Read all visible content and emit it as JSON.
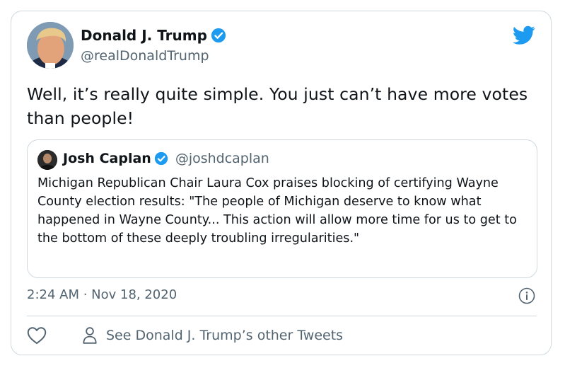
{
  "tweet": {
    "author_name": "Donald J. Trump",
    "author_handle": "@realDonaldTrump",
    "text": "Well, it’s really quite simple. You just can’t have more votes than people!",
    "timestamp": "2:24 AM · Nov 18, 2020"
  },
  "quoted_tweet": {
    "author_name": "Josh Caplan",
    "author_handle": "@joshdcaplan",
    "text": "Michigan Republican Chair Laura Cox praises blocking of certifying Wayne County election results: \"The people of Michigan deserve to know what happened in Wayne County... This action will allow more time for us to get to the bottom of these deeply troubling irregularities.\""
  },
  "actions": {
    "other_tweets_label": "See Donald J. Trump’s other Tweets"
  },
  "icons": {
    "verified": "verified-badge-icon",
    "brand": "twitter-bird-icon",
    "info": "info-icon",
    "like": "heart-icon",
    "profile": "person-icon"
  },
  "colors": {
    "brand_blue": "#1d9bf0",
    "text": "#0f1419",
    "secondary_text": "#536471",
    "border": "#cfd9de"
  }
}
